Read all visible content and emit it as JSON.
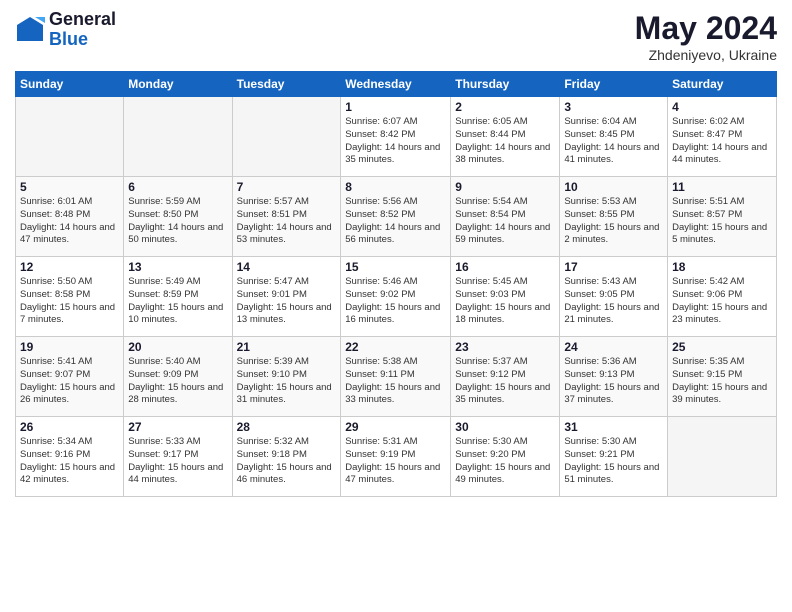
{
  "header": {
    "logo_general": "General",
    "logo_blue": "Blue",
    "month_year": "May 2024",
    "location": "Zhdeniyevo, Ukraine"
  },
  "days_of_week": [
    "Sunday",
    "Monday",
    "Tuesday",
    "Wednesday",
    "Thursday",
    "Friday",
    "Saturday"
  ],
  "weeks": [
    [
      {
        "num": "",
        "info": ""
      },
      {
        "num": "",
        "info": ""
      },
      {
        "num": "",
        "info": ""
      },
      {
        "num": "1",
        "info": "Sunrise: 6:07 AM\nSunset: 8:42 PM\nDaylight: 14 hours\nand 35 minutes."
      },
      {
        "num": "2",
        "info": "Sunrise: 6:05 AM\nSunset: 8:44 PM\nDaylight: 14 hours\nand 38 minutes."
      },
      {
        "num": "3",
        "info": "Sunrise: 6:04 AM\nSunset: 8:45 PM\nDaylight: 14 hours\nand 41 minutes."
      },
      {
        "num": "4",
        "info": "Sunrise: 6:02 AM\nSunset: 8:47 PM\nDaylight: 14 hours\nand 44 minutes."
      }
    ],
    [
      {
        "num": "5",
        "info": "Sunrise: 6:01 AM\nSunset: 8:48 PM\nDaylight: 14 hours\nand 47 minutes."
      },
      {
        "num": "6",
        "info": "Sunrise: 5:59 AM\nSunset: 8:50 PM\nDaylight: 14 hours\nand 50 minutes."
      },
      {
        "num": "7",
        "info": "Sunrise: 5:57 AM\nSunset: 8:51 PM\nDaylight: 14 hours\nand 53 minutes."
      },
      {
        "num": "8",
        "info": "Sunrise: 5:56 AM\nSunset: 8:52 PM\nDaylight: 14 hours\nand 56 minutes."
      },
      {
        "num": "9",
        "info": "Sunrise: 5:54 AM\nSunset: 8:54 PM\nDaylight: 14 hours\nand 59 minutes."
      },
      {
        "num": "10",
        "info": "Sunrise: 5:53 AM\nSunset: 8:55 PM\nDaylight: 15 hours\nand 2 minutes."
      },
      {
        "num": "11",
        "info": "Sunrise: 5:51 AM\nSunset: 8:57 PM\nDaylight: 15 hours\nand 5 minutes."
      }
    ],
    [
      {
        "num": "12",
        "info": "Sunrise: 5:50 AM\nSunset: 8:58 PM\nDaylight: 15 hours\nand 7 minutes."
      },
      {
        "num": "13",
        "info": "Sunrise: 5:49 AM\nSunset: 8:59 PM\nDaylight: 15 hours\nand 10 minutes."
      },
      {
        "num": "14",
        "info": "Sunrise: 5:47 AM\nSunset: 9:01 PM\nDaylight: 15 hours\nand 13 minutes."
      },
      {
        "num": "15",
        "info": "Sunrise: 5:46 AM\nSunset: 9:02 PM\nDaylight: 15 hours\nand 16 minutes."
      },
      {
        "num": "16",
        "info": "Sunrise: 5:45 AM\nSunset: 9:03 PM\nDaylight: 15 hours\nand 18 minutes."
      },
      {
        "num": "17",
        "info": "Sunrise: 5:43 AM\nSunset: 9:05 PM\nDaylight: 15 hours\nand 21 minutes."
      },
      {
        "num": "18",
        "info": "Sunrise: 5:42 AM\nSunset: 9:06 PM\nDaylight: 15 hours\nand 23 minutes."
      }
    ],
    [
      {
        "num": "19",
        "info": "Sunrise: 5:41 AM\nSunset: 9:07 PM\nDaylight: 15 hours\nand 26 minutes."
      },
      {
        "num": "20",
        "info": "Sunrise: 5:40 AM\nSunset: 9:09 PM\nDaylight: 15 hours\nand 28 minutes."
      },
      {
        "num": "21",
        "info": "Sunrise: 5:39 AM\nSunset: 9:10 PM\nDaylight: 15 hours\nand 31 minutes."
      },
      {
        "num": "22",
        "info": "Sunrise: 5:38 AM\nSunset: 9:11 PM\nDaylight: 15 hours\nand 33 minutes."
      },
      {
        "num": "23",
        "info": "Sunrise: 5:37 AM\nSunset: 9:12 PM\nDaylight: 15 hours\nand 35 minutes."
      },
      {
        "num": "24",
        "info": "Sunrise: 5:36 AM\nSunset: 9:13 PM\nDaylight: 15 hours\nand 37 minutes."
      },
      {
        "num": "25",
        "info": "Sunrise: 5:35 AM\nSunset: 9:15 PM\nDaylight: 15 hours\nand 39 minutes."
      }
    ],
    [
      {
        "num": "26",
        "info": "Sunrise: 5:34 AM\nSunset: 9:16 PM\nDaylight: 15 hours\nand 42 minutes."
      },
      {
        "num": "27",
        "info": "Sunrise: 5:33 AM\nSunset: 9:17 PM\nDaylight: 15 hours\nand 44 minutes."
      },
      {
        "num": "28",
        "info": "Sunrise: 5:32 AM\nSunset: 9:18 PM\nDaylight: 15 hours\nand 46 minutes."
      },
      {
        "num": "29",
        "info": "Sunrise: 5:31 AM\nSunset: 9:19 PM\nDaylight: 15 hours\nand 47 minutes."
      },
      {
        "num": "30",
        "info": "Sunrise: 5:30 AM\nSunset: 9:20 PM\nDaylight: 15 hours\nand 49 minutes."
      },
      {
        "num": "31",
        "info": "Sunrise: 5:30 AM\nSunset: 9:21 PM\nDaylight: 15 hours\nand 51 minutes."
      },
      {
        "num": "",
        "info": ""
      }
    ]
  ]
}
